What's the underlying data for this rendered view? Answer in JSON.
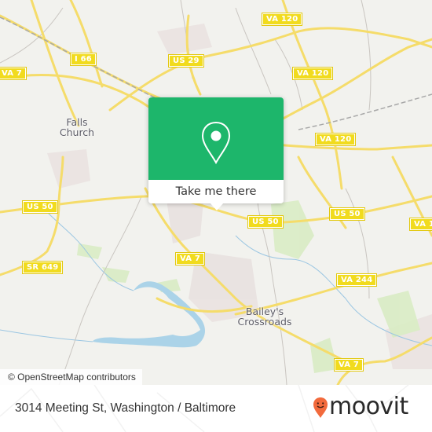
{
  "map": {
    "attribution": "© OpenStreetMap contributors",
    "road_shields": [
      {
        "label": "VA 120"
      },
      {
        "label": "I 66"
      },
      {
        "label": "US 29"
      },
      {
        "label": "VA 7"
      },
      {
        "label": "VA 120"
      },
      {
        "label": "VA 120"
      },
      {
        "label": "US 50"
      },
      {
        "label": "US 50"
      },
      {
        "label": "US 50"
      },
      {
        "label": "VA 1"
      },
      {
        "label": "SR 649"
      },
      {
        "label": "VA 7"
      },
      {
        "label": "VA 244"
      },
      {
        "label": "VA 7"
      }
    ],
    "places": [
      {
        "line1": "Falls",
        "line2": "Church"
      },
      {
        "line1": "Bailey's",
        "line2": "Crossroads"
      }
    ]
  },
  "popup": {
    "icon": "map-pin-icon",
    "action_label": "Take me there",
    "color": "#1db66b"
  },
  "footer": {
    "address": "3014 Meeting St, Washington / Baltimore",
    "brand": "moovit",
    "brand_color": "#f26a3c"
  }
}
